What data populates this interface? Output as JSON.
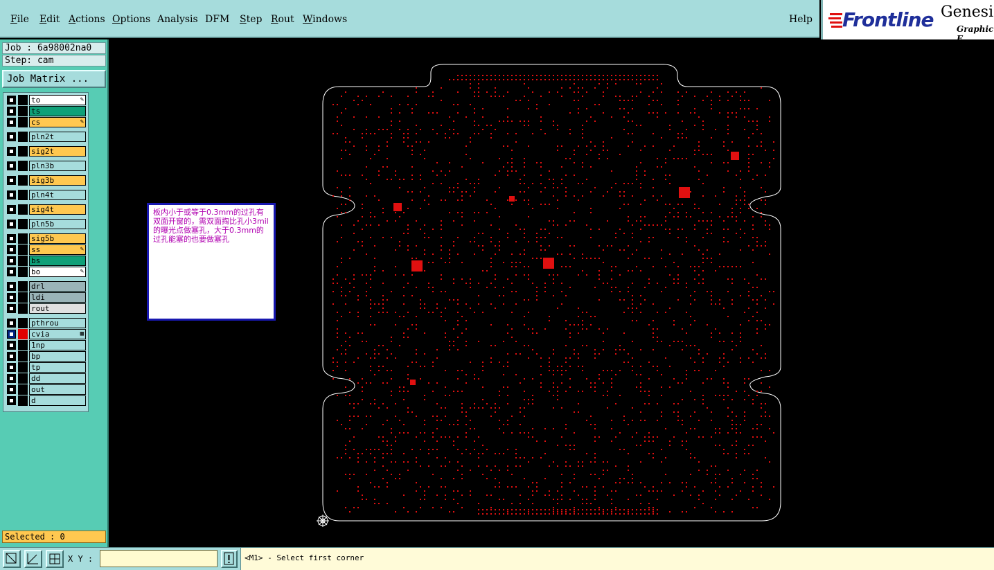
{
  "menubar": {
    "items": [
      {
        "label": "File",
        "u": "F",
        "rest": "ile"
      },
      {
        "label": "Edit",
        "u": "E",
        "rest": "dit"
      },
      {
        "label": "Actions",
        "u": "A",
        "rest": "ctions"
      },
      {
        "label": "Options",
        "u": "O",
        "rest": "ptions"
      },
      {
        "label": "Analysis",
        "u": "",
        "rest": "Analysis"
      },
      {
        "label": "DFM",
        "u": "",
        "rest": "DFM"
      },
      {
        "label": "Step",
        "u": "S",
        "rest": "tep"
      },
      {
        "label": "Rout",
        "u": "R",
        "rest": "out"
      },
      {
        "label": "Windows",
        "u": "W",
        "rest": "indows"
      }
    ],
    "help": "Help"
  },
  "logo": {
    "brand": "Frontline",
    "product": "Genesis",
    "subtitle": "Graphic E"
  },
  "panel": {
    "job": "Job : 6a98002na0",
    "step": "Step: cam",
    "job_matrix": "Job Matrix ...",
    "selected": "Selected : 0"
  },
  "layers": [
    {
      "name": "to",
      "color": "#ffffff",
      "mark": "✎"
    },
    {
      "name": "ts",
      "color": "#0fa078",
      "mark": ""
    },
    {
      "name": "cs",
      "color": "#ffc850",
      "mark": "✎"
    },
    {
      "name": "pln2t",
      "color": "#a6dcdc",
      "mark": ""
    },
    {
      "name": "sig2t",
      "color": "#ffc850",
      "mark": ""
    },
    {
      "name": "pln3b",
      "color": "#a6dcdc",
      "mark": ""
    },
    {
      "name": "sig3b",
      "color": "#ffc850",
      "mark": ""
    },
    {
      "name": "pln4t",
      "color": "#a6dcdc",
      "mark": ""
    },
    {
      "name": "sig4t",
      "color": "#ffc850",
      "mark": ""
    },
    {
      "name": "pln5b",
      "color": "#a6dcdc",
      "mark": ""
    },
    {
      "name": "sig5b",
      "color": "#ffc850",
      "mark": ""
    },
    {
      "name": "ss",
      "color": "#ffc850",
      "mark": "✎"
    },
    {
      "name": "bs",
      "color": "#0fa078",
      "mark": ""
    },
    {
      "name": "bo",
      "color": "#ffffff",
      "mark": "✎"
    },
    {
      "name": "drl",
      "color": "#9ab4b8",
      "mark": ""
    },
    {
      "name": "ldi",
      "color": "#9ab4b8",
      "mark": ""
    },
    {
      "name": "rout",
      "color": "#e0e0e0",
      "mark": ""
    },
    {
      "name": "pthrou",
      "color": "#a6dcdc",
      "mark": ""
    },
    {
      "name": "cvia",
      "color": "#a6dcdc",
      "mark": "▦",
      "active": true,
      "swatch": "#e00000"
    },
    {
      "name": "1np",
      "color": "#a6dcdc",
      "mark": ""
    },
    {
      "name": "bp",
      "color": "#a6dcdc",
      "mark": ""
    },
    {
      "name": "tp",
      "color": "#a6dcdc",
      "mark": ""
    },
    {
      "name": "dd",
      "color": "#a6dcdc",
      "mark": ""
    },
    {
      "name": "out",
      "color": "#a6dcdc",
      "mark": ""
    },
    {
      "name": "d",
      "color": "#a6dcdc",
      "mark": ""
    }
  ],
  "note": {
    "text": "板内小于或等于0.3mm的过孔有双面开窗的，需双面掏比孔小3mil的曝光点做塞孔，大于0.3mm的过孔能塞的也要做塞孔"
  },
  "bottom": {
    "xy_label": "X Y :",
    "xy_value": "",
    "status": "<M1> - Select first corner"
  },
  "colors": {
    "via": "#e01010",
    "outline": "#ffffff",
    "panel": "#57ccb4",
    "menubar": "#a6dcdc"
  }
}
